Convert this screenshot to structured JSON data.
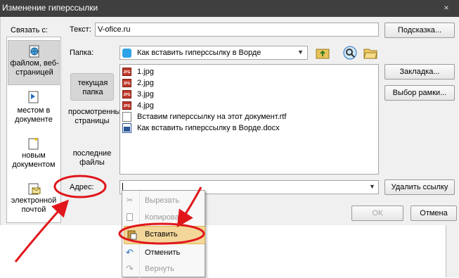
{
  "window": {
    "title": "Изменение гиперссылки",
    "close_glyph": "×"
  },
  "link_to": {
    "label": "Связать с:",
    "items": [
      {
        "label": "файлом, веб-страницей",
        "icon": "globe-file-icon",
        "selected": true
      },
      {
        "label": "местом в документе",
        "icon": "bookmark-doc-icon",
        "selected": false
      },
      {
        "label": "новым документом",
        "icon": "new-doc-icon",
        "selected": false
      },
      {
        "label": "электронной почтой",
        "icon": "email-icon",
        "selected": false
      }
    ]
  },
  "text_field": {
    "label": "Текст:",
    "value": "V-ofice.ru"
  },
  "hint_button": "Подсказка...",
  "folder": {
    "label": "Папка:",
    "value": "Как вставить гиперссылку в Ворде"
  },
  "look_in": {
    "items": [
      {
        "label": "текущая папка",
        "selected": true
      },
      {
        "label": "просмотренные страницы",
        "selected": false
      },
      {
        "label": "последние файлы",
        "selected": false
      }
    ]
  },
  "files": [
    {
      "name": "1.jpg",
      "type": "jpg"
    },
    {
      "name": "2.jpg",
      "type": "jpg"
    },
    {
      "name": "3.jpg",
      "type": "jpg"
    },
    {
      "name": "4.jpg",
      "type": "jpg"
    },
    {
      "name": "Вставим гиперссылку на этот документ.rtf",
      "type": "rtf"
    },
    {
      "name": "Как вставить гиперссылку в Ворде.docx",
      "type": "docx"
    }
  ],
  "jpg_badge": "JPG",
  "right_buttons": {
    "bookmark": "Закладка...",
    "target_frame": "Выбор рамки...",
    "remove_link": "Удалить ссылку"
  },
  "address": {
    "label": "Адрес:",
    "value": ""
  },
  "ok_button": "ОК",
  "cancel_button": "Отмена",
  "context_menu": {
    "items": [
      {
        "label": "Вырезать",
        "icon": "scissors-icon",
        "enabled": false
      },
      {
        "label": "Копировать",
        "icon": "copy-icon",
        "enabled": false
      },
      {
        "label": "Вставить",
        "icon": "paste-icon",
        "enabled": true,
        "highlighted": true
      },
      {
        "label": "Отменить",
        "icon": "undo-icon",
        "enabled": true
      },
      {
        "label": "Вернуть",
        "icon": "redo-icon",
        "enabled": false
      }
    ]
  },
  "colors": {
    "annotation": "#e0161b",
    "title_bar": "#3f3f3f",
    "menu_highlight": "#f3d79a"
  }
}
